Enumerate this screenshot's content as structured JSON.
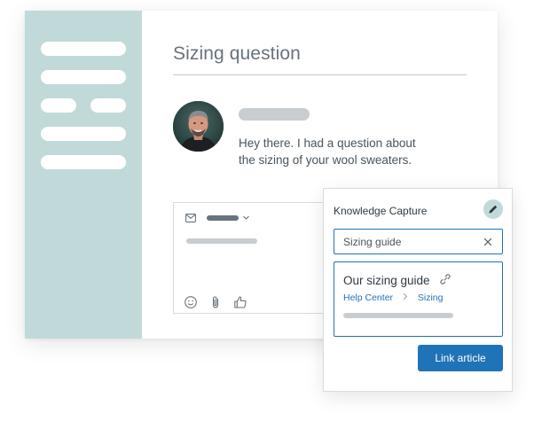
{
  "ticket": {
    "title": "Sizing question",
    "message_lines": [
      "Hey there. I had a question about",
      "the sizing of your wool sweaters."
    ]
  },
  "composer": {
    "icons": [
      "mail-icon",
      "chevron-down-icon",
      "emoji-icon",
      "paperclip-icon",
      "thumbs-up-icon"
    ]
  },
  "knowledge_capture": {
    "title": "Knowledge Capture",
    "edit_icon": "pencil-icon",
    "search_value": "Sizing guide",
    "clear_icon": "close-icon",
    "result": {
      "title": "Our sizing guide",
      "link_icon": "link-icon",
      "breadcrumb": [
        "Help Center",
        "Sizing"
      ],
      "breadcrumb_separator_icon": "chevron-right-icon"
    },
    "button_label": "Link article"
  },
  "colors": {
    "sidebar": "#c1dad9",
    "accent": "#1f73b7",
    "placeholder_bar": "#c8cdd0",
    "text": "#49545c"
  }
}
